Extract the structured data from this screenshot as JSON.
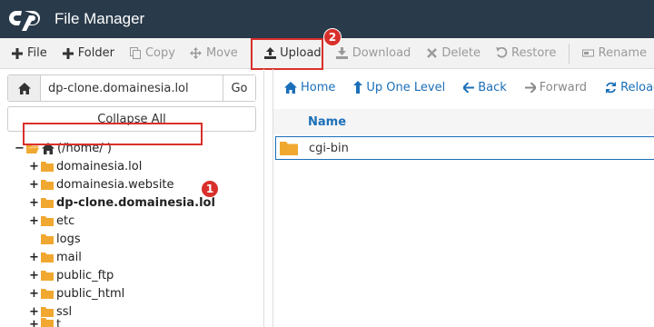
{
  "header": {
    "title": "File Manager"
  },
  "toolbar": {
    "file": "File",
    "folder": "Folder",
    "copy": "Copy",
    "move": "Move",
    "upload": "Upload",
    "download": "Download",
    "delete": "Delete",
    "restore": "Restore",
    "rename": "Rename"
  },
  "left": {
    "path_value": "dp-clone.domainesia.lol",
    "go": "Go",
    "collapse_all": "Collapse All"
  },
  "tree": {
    "root": "(/home/              )",
    "items": [
      "domainesia.lol",
      "domainesia.website",
      "dp-clone.domainesia.lol",
      "etc",
      "logs",
      "mail",
      "public_ftp",
      "public_html",
      "ssl",
      "t"
    ]
  },
  "right": {
    "home": "Home",
    "up": "Up One Level",
    "back": "Back",
    "forward": "Forward",
    "reload": "Reload",
    "col_name": "Name",
    "files": [
      "cgi-bin"
    ]
  },
  "annotations": {
    "badge1": "1",
    "badge2": "2"
  },
  "colors": {
    "header": "#293a4a",
    "accent": "#1b6fb8",
    "folder": "#f0a830",
    "highlight": "#d9302b"
  }
}
